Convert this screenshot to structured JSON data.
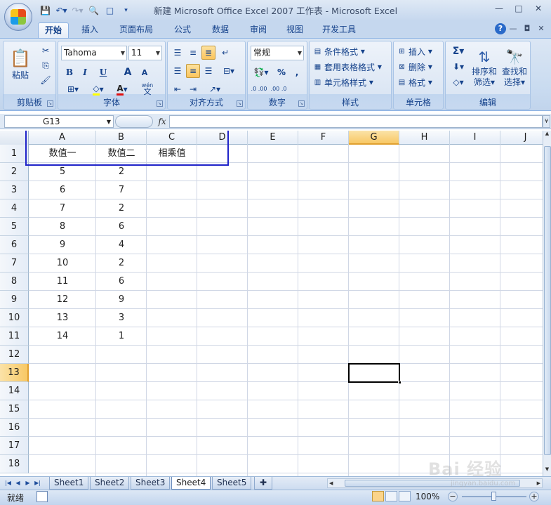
{
  "window": {
    "title": "新建 Microsoft Office Excel 2007 工作表 - Microsoft Excel"
  },
  "ribbon_tabs": [
    "开始",
    "插入",
    "页面布局",
    "公式",
    "数据",
    "审阅",
    "视图",
    "开发工具"
  ],
  "active_tab": "开始",
  "groups": {
    "clipboard": {
      "label": "剪贴板",
      "paste": "粘贴"
    },
    "font": {
      "label": "字体",
      "family": "Tahoma",
      "size": "11",
      "bold": "B",
      "italic": "I",
      "underline": "U",
      "grow": "A",
      "shrink": "A",
      "wen": "wén",
      "wen_char": "文"
    },
    "alignment": {
      "label": "对齐方式"
    },
    "number": {
      "label": "数字",
      "format": "常规",
      "percent": "%",
      "comma": ",",
      "inc": ".0 .00",
      "dec": ".00 .0"
    },
    "styles": {
      "label": "样式",
      "conditional": "条件格式",
      "table": "套用表格格式",
      "cell": "单元格样式"
    },
    "cells": {
      "label": "单元格",
      "insert": "插入",
      "delete": "删除",
      "format": "格式"
    },
    "editing": {
      "label": "编辑",
      "sort": "排序和",
      "sort2": "筛选",
      "find": "查找和",
      "find2": "选择",
      "sigma": "Σ"
    }
  },
  "formula_bar": {
    "name_box": "G13",
    "fx": "fx",
    "formula": ""
  },
  "grid": {
    "columns": [
      "A",
      "B",
      "C",
      "D",
      "E",
      "F",
      "G",
      "H",
      "I",
      "J"
    ],
    "rows": [
      "1",
      "2",
      "3",
      "4",
      "5",
      "6",
      "7",
      "8",
      "9",
      "10",
      "11",
      "12",
      "13",
      "14",
      "15",
      "16",
      "17",
      "18"
    ],
    "selected_column": "G",
    "selected_row": "13",
    "headers": [
      "数值一",
      "数值二",
      "相乘值"
    ],
    "col_a": [
      "5",
      "6",
      "7",
      "8",
      "9",
      "10",
      "11",
      "12",
      "13",
      "14"
    ],
    "col_b": [
      "2",
      "7",
      "2",
      "6",
      "4",
      "2",
      "6",
      "9",
      "3",
      "1"
    ]
  },
  "sheets": [
    "Sheet1",
    "Sheet2",
    "Sheet3",
    "Sheet4",
    "Sheet5"
  ],
  "active_sheet": "Sheet4",
  "status": {
    "ready": "就绪",
    "zoom": "100%"
  },
  "watermark": {
    "main": "Bai 经验",
    "sub": "jingyan.baidu.com"
  },
  "colors": {
    "highlight_box": "#1f23c9",
    "selected_header": "#f8c865"
  }
}
